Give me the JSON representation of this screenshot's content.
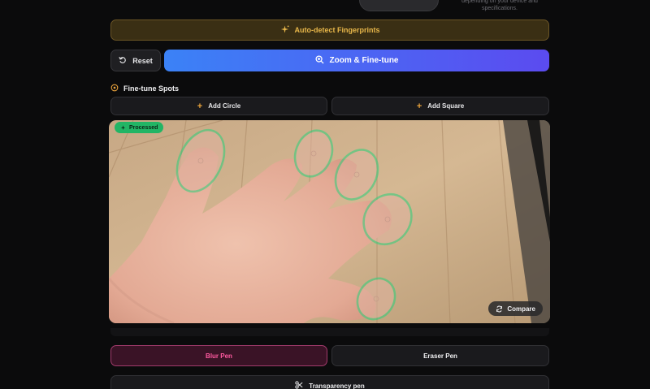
{
  "header": {
    "note": "depending on your device and specifications."
  },
  "actions": {
    "auto_detect_label": "Auto-detect Fingerprints",
    "reset_label": "Reset",
    "zoom_label": "Zoom & Fine-tune"
  },
  "finetune": {
    "title": "Fine-tune Spots",
    "add_circle_label": "Add Circle",
    "add_square_label": "Add Square"
  },
  "preview": {
    "badge_label": "Processed",
    "compare_label": "Compare"
  },
  "pens": {
    "blur_label": "Blur Pen",
    "eraser_label": "Eraser Pen",
    "transparency_label": "Transparency pen"
  },
  "colors": {
    "accent_blue": "#3b82f6",
    "accent_purple": "#5b4bf0",
    "gold": "#e8b74a",
    "pink": "#ff5aa0",
    "green": "#22b565"
  },
  "icons": {
    "auto_detect": "sparkle-icon",
    "reset": "rotate-ccw-icon",
    "zoom": "zoom-in-icon",
    "section": "target-icon",
    "add": "plus-icon",
    "compare": "refresh-icon",
    "transparency": "scissors-icon"
  }
}
